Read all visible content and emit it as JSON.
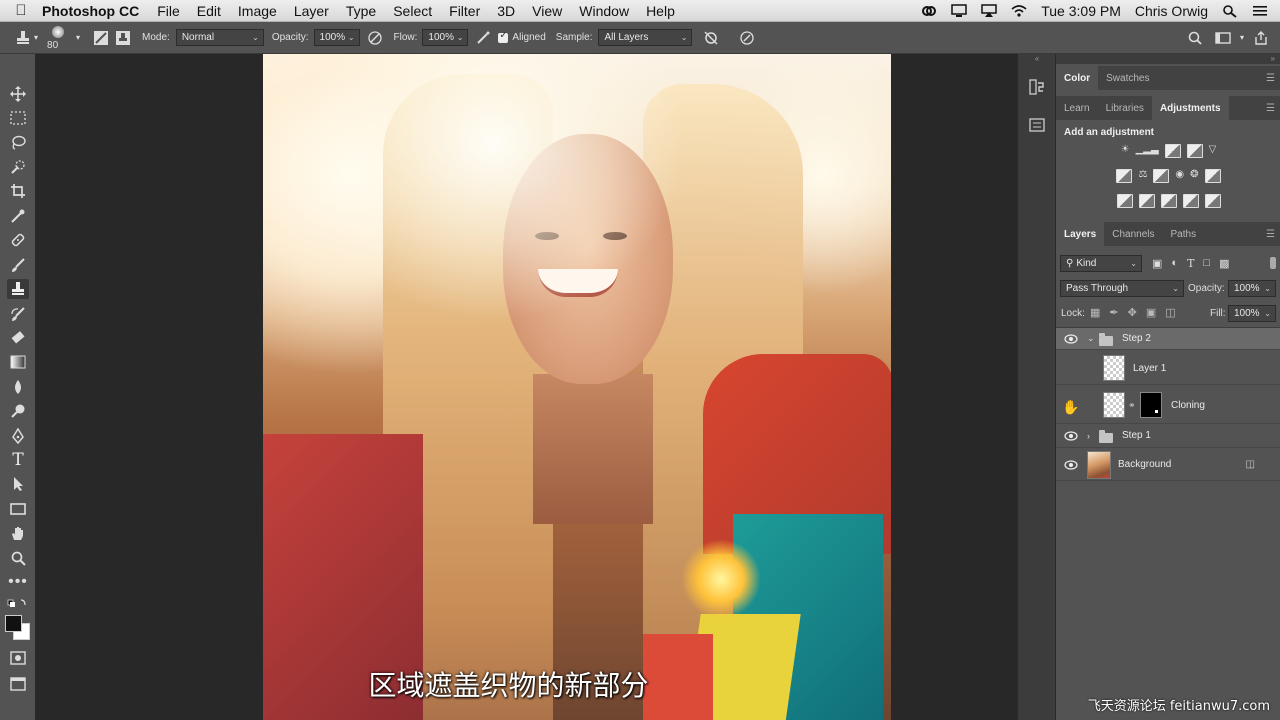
{
  "menubar": {
    "app_name": "Photoshop CC",
    "menus": [
      "File",
      "Edit",
      "Image",
      "Layer",
      "Type",
      "Select",
      "Filter",
      "3D",
      "View",
      "Window",
      "Help"
    ],
    "clock": "Tue 3:09 PM",
    "user": "Chris Orwig"
  },
  "options": {
    "brush_size": "80",
    "mode_label": "Mode:",
    "mode_value": "Normal",
    "opacity_label": "Opacity:",
    "opacity_value": "100%",
    "flow_label": "Flow:",
    "flow_value": "100%",
    "aligned_label": "Aligned",
    "aligned_checked": true,
    "sample_label": "Sample:",
    "sample_value": "All Layers"
  },
  "subtitle": "区域遮盖织物的新部分",
  "watermark": "飞天资源论坛 feitianwu7.com",
  "panels": {
    "color_tabs": [
      "Color",
      "Swatches"
    ],
    "adj_tabs": [
      "Learn",
      "Libraries",
      "Adjustments"
    ],
    "active_adj_tab": "Adjustments",
    "add_adjustment": "Add an adjustment",
    "layer_tabs": [
      "Layers",
      "Channels",
      "Paths"
    ],
    "filter_kind": "Kind",
    "blend_mode": "Pass Through",
    "opacity_label": "Opacity:",
    "opacity_value": "100%",
    "lock_label": "Lock:",
    "fill_label": "Fill:",
    "fill_value": "100%",
    "layers": [
      {
        "name": "Step 2",
        "type": "group",
        "expanded": true,
        "visible": true,
        "selected": true
      },
      {
        "name": "Layer 1",
        "type": "pixel",
        "visible": false
      },
      {
        "name": "Cloning",
        "type": "masked",
        "visible": false
      },
      {
        "name": "Step 1",
        "type": "group",
        "expanded": false,
        "visible": true
      },
      {
        "name": "Background",
        "type": "background",
        "visible": true,
        "locked": true
      }
    ]
  },
  "colors": {
    "ui_dark": "#535353",
    "canvas_bg": "#282828",
    "panel_tab_bg": "#424242"
  }
}
